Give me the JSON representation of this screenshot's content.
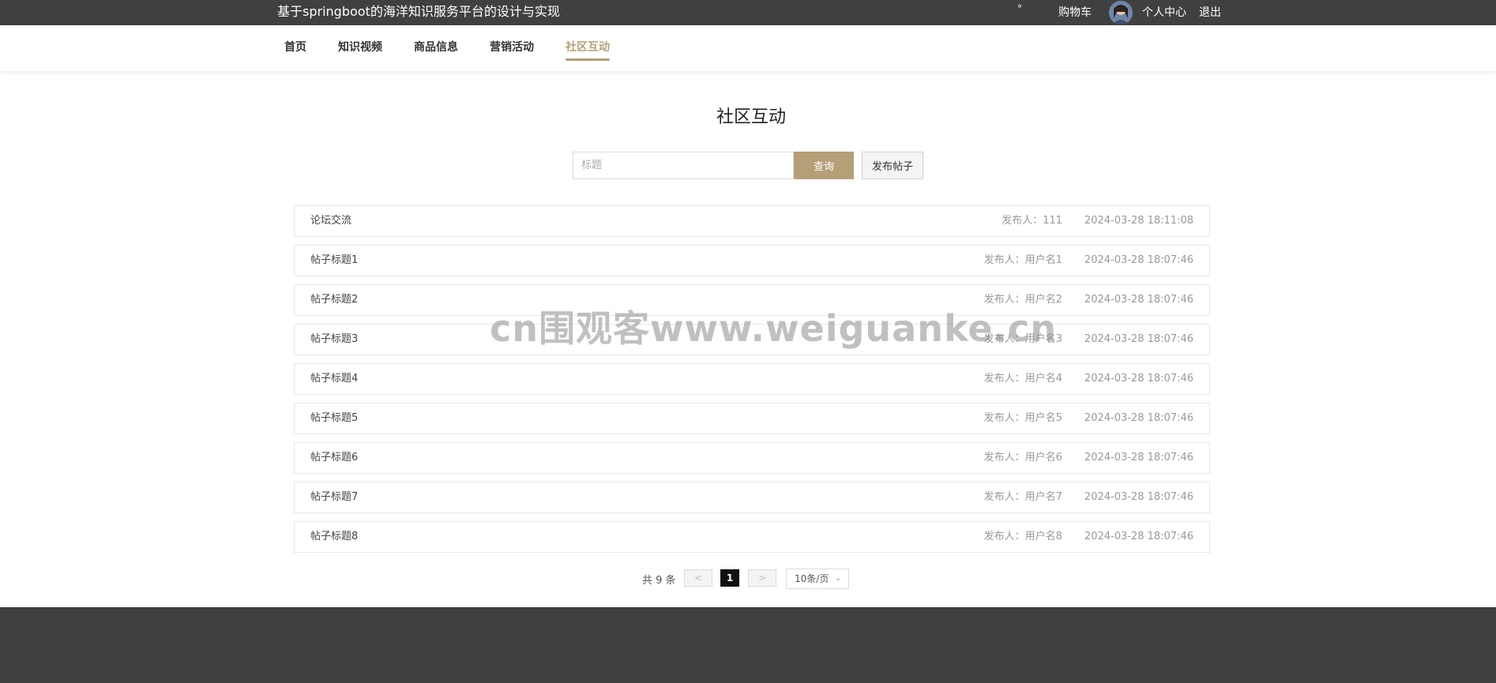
{
  "header": {
    "site_title": "基于springboot的海洋知识服务平台的设计与实现",
    "degree_mark": "°",
    "cart_label": "购物车",
    "center_label": "个人中心",
    "logout_label": "退出"
  },
  "nav": {
    "items": [
      {
        "label": "首页"
      },
      {
        "label": "知识视频"
      },
      {
        "label": "商品信息"
      },
      {
        "label": "营销活动"
      },
      {
        "label": "社区互动",
        "active": true
      }
    ]
  },
  "page": {
    "title": "社区互动",
    "search_placeholder": "标题",
    "query_label": "查询",
    "post_label": "发布帖子"
  },
  "posts": [
    {
      "title": "论坛交流",
      "author": "发布人：111",
      "time": "2024-03-28 18:11:08"
    },
    {
      "title": "帖子标题1",
      "author": "发布人：用户名1",
      "time": "2024-03-28 18:07:46"
    },
    {
      "title": "帖子标题2",
      "author": "发布人：用户名2",
      "time": "2024-03-28 18:07:46"
    },
    {
      "title": "帖子标题3",
      "author": "发布人：用户名3",
      "time": "2024-03-28 18:07:46"
    },
    {
      "title": "帖子标题4",
      "author": "发布人：用户名4",
      "time": "2024-03-28 18:07:46"
    },
    {
      "title": "帖子标题5",
      "author": "发布人：用户名5",
      "time": "2024-03-28 18:07:46"
    },
    {
      "title": "帖子标题6",
      "author": "发布人：用户名6",
      "time": "2024-03-28 18:07:46"
    },
    {
      "title": "帖子标题7",
      "author": "发布人：用户名7",
      "time": "2024-03-28 18:07:46"
    },
    {
      "title": "帖子标题8",
      "author": "发布人：用户名8",
      "time": "2024-03-28 18:07:46"
    }
  ],
  "pagination": {
    "total": "共 9 条",
    "prev": "<",
    "current": "1",
    "next": ">",
    "page_size": "10条/页"
  },
  "watermark": "cn围观客www.weiguanke.cn",
  "colors": {
    "accent": "#b59f76",
    "topbar": "#404040",
    "footer": "#404040"
  }
}
